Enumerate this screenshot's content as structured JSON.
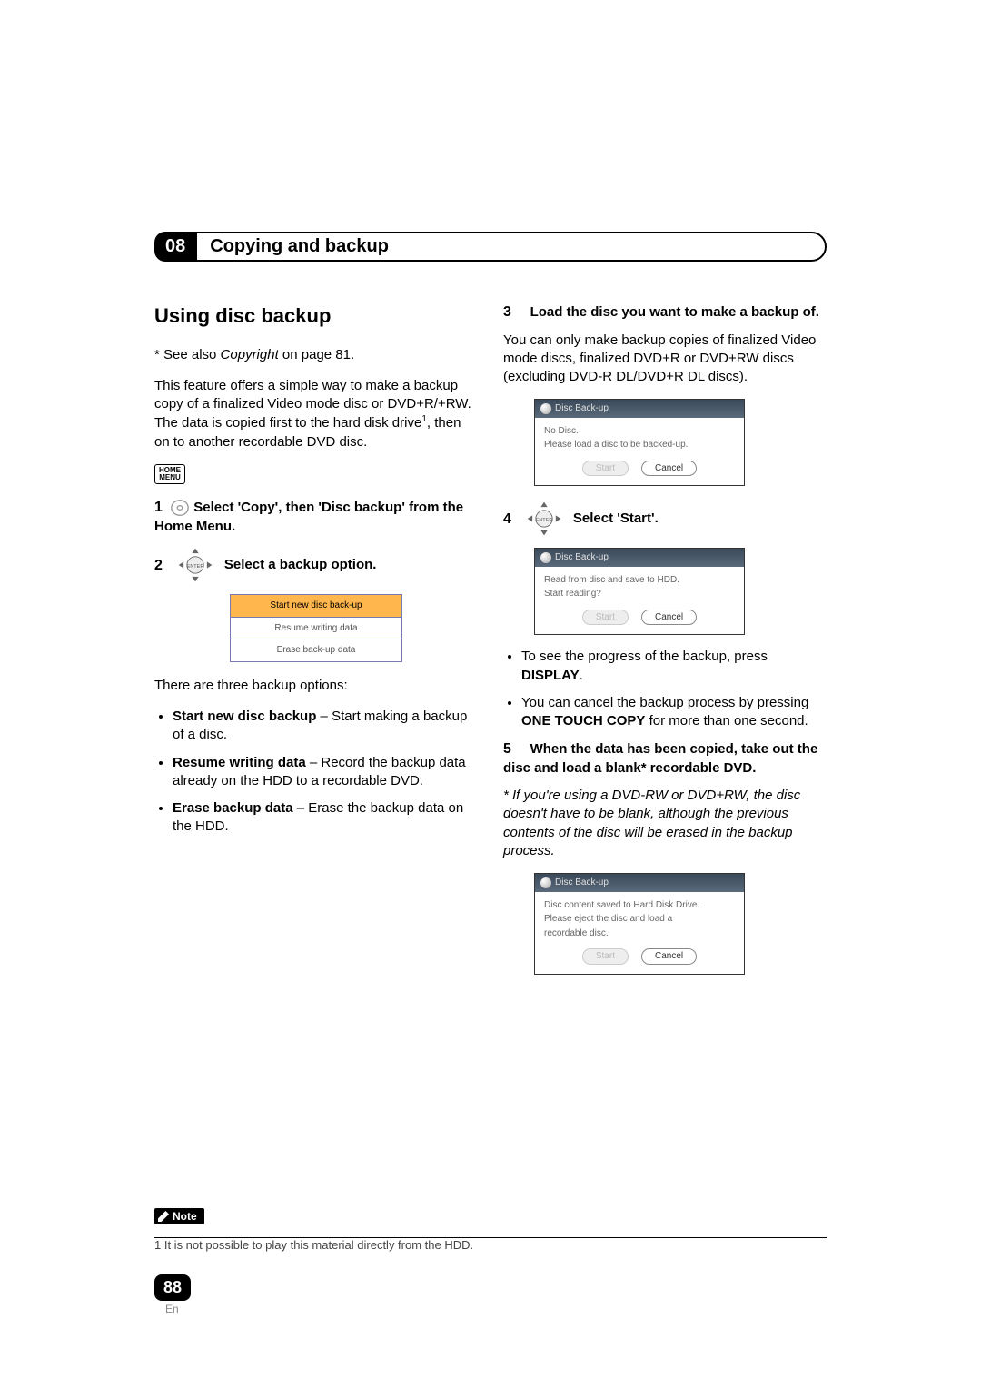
{
  "chapter": {
    "number": "08",
    "title": "Copying and backup"
  },
  "left": {
    "heading": "Using disc backup",
    "seeAlso_prefix": "* See also ",
    "seeAlso_emph": "Copyright",
    "seeAlso_suffix": " on page 81.",
    "intro_a": "This feature offers a simple way to make a backup copy of a finalized Video mode disc or DVD+R/+RW. The data is copied first to the hard disk drive",
    "intro_sup": "1",
    "intro_b": ", then on to another recordable DVD disc.",
    "homeMenu": "HOME\nMENU",
    "step1_num": "1",
    "step1_text": "Select 'Copy', then 'Disc backup' from the Home Menu.",
    "step2_num": "2",
    "step2_text": "Select a backup option.",
    "options": [
      "Start new disc back-up",
      "Resume writing data",
      "Erase back-up data"
    ],
    "threeOptions": "There are three backup options:",
    "bul1_b": "Start new disc backup",
    "bul1_r": " – Start making a backup of a disc.",
    "bul2_b": "Resume writing data",
    "bul2_r": " – Record the backup data already on the HDD to a recordable DVD.",
    "bul3_b": "Erase backup data",
    "bul3_r": " – Erase the backup data on the HDD."
  },
  "right": {
    "step3_num": "3",
    "step3_bold": "Load the disc you want to make a backup of.",
    "step3_para": "You can only make backup copies of finalized Video mode discs, finalized DVD+R or  DVD+RW discs (excluding DVD-R DL/DVD+R DL discs).",
    "dlg1_title": "Disc Back-up",
    "dlg1_l1": "No Disc.",
    "dlg1_l2": "Please load a disc to be backed-up.",
    "btn_start": "Start",
    "btn_cancel": "Cancel",
    "step4_num": "4",
    "step4_text": "Select 'Start'.",
    "dlg2_title": "Disc Back-up",
    "dlg2_l1": "Read from disc and save to HDD.",
    "dlg2_l2": "Start reading?",
    "bulA_a": "To see the progress of the backup, press ",
    "bulA_b": "DISPLAY",
    "bulA_c": ".",
    "bulB_a": "You can cancel the backup process by pressing ",
    "bulB_b": "ONE TOUCH COPY",
    "bulB_c": " for more than one second.",
    "step5_num": "5",
    "step5_bold": "When the data has been copied, take out the disc and load a blank* recordable DVD.",
    "step5_italic": "* If you're using a DVD-RW or DVD+RW, the disc doesn't have to be blank, although the previous contents of the disc will be erased in the backup process.",
    "dlg3_title": "Disc Back-up",
    "dlg3_l1": "Disc content saved to Hard Disk Drive.",
    "dlg3_l2": "Please eject the disc and load a",
    "dlg3_l3": "recordable disc."
  },
  "note": {
    "label": "Note",
    "text": "1 It is not possible to play this material directly from the HDD."
  },
  "page": {
    "number": "88",
    "lang": "En"
  }
}
